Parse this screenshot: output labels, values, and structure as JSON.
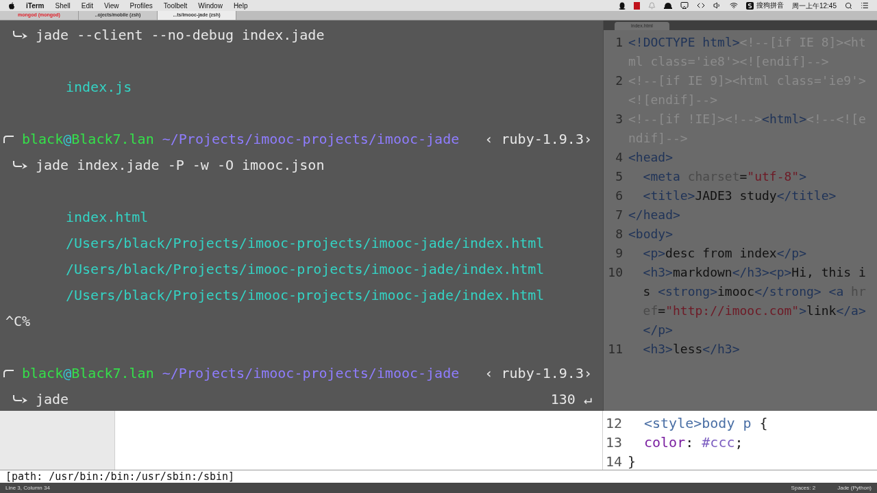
{
  "menu_bar": {
    "app": "iTerm",
    "items": [
      "Shell",
      "Edit",
      "View",
      "Profiles",
      "Toolbelt",
      "Window",
      "Help"
    ],
    "input_method": "搜狗拼音",
    "clock": "周一上午12:45"
  },
  "terminal_tabs": [
    {
      "label": "mongod (mongod)",
      "selected": false,
      "kind": "alert"
    },
    {
      "label": "..ojects/mobile (zsh)",
      "selected": false,
      "kind": "normal"
    },
    {
      "label": "...ts/imooc-jade (zsh)",
      "selected": true,
      "kind": "normal"
    }
  ],
  "terminal": {
    "lines": [
      {
        "kind": "command",
        "text": "jade --client --no-debug index.jade"
      },
      {
        "kind": "blank"
      },
      {
        "kind": "output",
        "text": "index.js"
      },
      {
        "kind": "blank"
      },
      {
        "kind": "prompt",
        "user": "black",
        "at": "@",
        "host": "Black7.lan",
        "path": "~/Projects/imooc-projects/imooc-jade",
        "right": "‹ ruby-1.9.3›"
      },
      {
        "kind": "command",
        "text": "jade index.jade -P -w -O imooc.json"
      },
      {
        "kind": "blank"
      },
      {
        "kind": "output",
        "text": "index.html"
      },
      {
        "kind": "output",
        "text": "/Users/black/Projects/imooc-projects/imooc-jade/index.html"
      },
      {
        "kind": "output",
        "text": "/Users/black/Projects/imooc-projects/imooc-jade/index.html"
      },
      {
        "kind": "output",
        "text": "/Users/black/Projects/imooc-projects/imooc-jade/index.html"
      },
      {
        "kind": "plain",
        "text": "^C%"
      },
      {
        "kind": "blank"
      },
      {
        "kind": "prompt",
        "user": "black",
        "at": "@",
        "host": "Black7.lan",
        "path": "~/Projects/imooc-projects/imooc-jade",
        "right": "‹ ruby-1.9.3›"
      },
      {
        "kind": "command",
        "text": "jade",
        "right": "130 ↵"
      }
    ],
    "path_line": "[path: /usr/bin:/bin:/usr/sbin:/sbin]"
  },
  "editor": {
    "tab": "index.html",
    "lines": [
      {
        "number": "1",
        "segments": [
          {
            "kind": "tag",
            "text": "<!DOCTYPE html>"
          },
          {
            "kind": "comment",
            "text": "<!--[if IE 8]><html class='ie8'><![endif]-->"
          }
        ]
      },
      {
        "number": "2",
        "segments": [
          {
            "kind": "comment",
            "text": "<!--[if IE 9]><html class='ie9'><![endif]-->"
          }
        ]
      },
      {
        "number": "3",
        "segments": [
          {
            "kind": "comment",
            "text": "<!--[if !IE]><!-->"
          },
          {
            "kind": "tag",
            "text": "<html>"
          },
          {
            "kind": "comment",
            "text": "<!--<![endif]-->"
          }
        ]
      },
      {
        "number": "4",
        "segments": [
          {
            "kind": "tag",
            "text": "<head>"
          }
        ]
      },
      {
        "number": "5",
        "indent": true,
        "segments": [
          {
            "kind": "tag",
            "text": "<meta "
          },
          {
            "kind": "attr",
            "text": "charset"
          },
          {
            "kind": "text",
            "text": "="
          },
          {
            "kind": "string",
            "text": "\"utf-8\""
          },
          {
            "kind": "tag",
            "text": ">"
          }
        ]
      },
      {
        "number": "6",
        "indent": true,
        "segments": [
          {
            "kind": "tag",
            "text": "<title>"
          },
          {
            "kind": "text",
            "text": "JADE3 study"
          },
          {
            "kind": "tag",
            "text": "</title>"
          }
        ]
      },
      {
        "number": "7",
        "segments": [
          {
            "kind": "tag",
            "text": "</head>"
          }
        ]
      },
      {
        "number": "8",
        "segments": [
          {
            "kind": "tag",
            "text": "<body>"
          }
        ]
      },
      {
        "number": "9",
        "indent": true,
        "segments": [
          {
            "kind": "tag",
            "text": "<p>"
          },
          {
            "kind": "text",
            "text": "desc from index"
          },
          {
            "kind": "tag",
            "text": "</p>"
          }
        ]
      },
      {
        "number": "10",
        "indent": true,
        "segments": [
          {
            "kind": "tag",
            "text": "<h3>"
          },
          {
            "kind": "text",
            "text": "markdown"
          },
          {
            "kind": "tag",
            "text": "</h3><p>"
          },
          {
            "kind": "text",
            "text": "Hi, this is "
          },
          {
            "kind": "tag",
            "text": "<strong>"
          },
          {
            "kind": "text",
            "text": "imooc"
          },
          {
            "kind": "tag",
            "text": "</strong> <a "
          },
          {
            "kind": "attr",
            "text": "href"
          },
          {
            "kind": "text",
            "text": "="
          },
          {
            "kind": "string",
            "text": "\"http://imooc.com\""
          },
          {
            "kind": "tag",
            "text": ">"
          },
          {
            "kind": "text",
            "text": "link"
          },
          {
            "kind": "tag",
            "text": "</a></p>"
          }
        ]
      },
      {
        "number": "11",
        "indent": true,
        "segments": [
          {
            "kind": "tag",
            "text": "<h3>"
          },
          {
            "kind": "text",
            "text": "less"
          },
          {
            "kind": "tag",
            "text": "</h3>"
          }
        ]
      }
    ],
    "lower_lines": [
      {
        "number": "12",
        "indent": true,
        "segments": [
          {
            "kind": "tag",
            "text": "<style>body p "
          },
          {
            "kind": "text",
            "text": "{"
          }
        ]
      },
      {
        "number": "13",
        "indent": true,
        "segments": [
          {
            "kind": "attr",
            "text": "color"
          },
          {
            "kind": "text",
            "text": ": "
          },
          {
            "kind": "string",
            "text": "#ccc"
          },
          {
            "kind": "text",
            "text": ";"
          }
        ]
      },
      {
        "number": "14",
        "segments": [
          {
            "kind": "text",
            "text": "}"
          }
        ]
      }
    ]
  },
  "status_bar": {
    "position": "Line 3, Column 34",
    "indent": "Spaces: 2",
    "syntax": "Jade (Python)"
  }
}
